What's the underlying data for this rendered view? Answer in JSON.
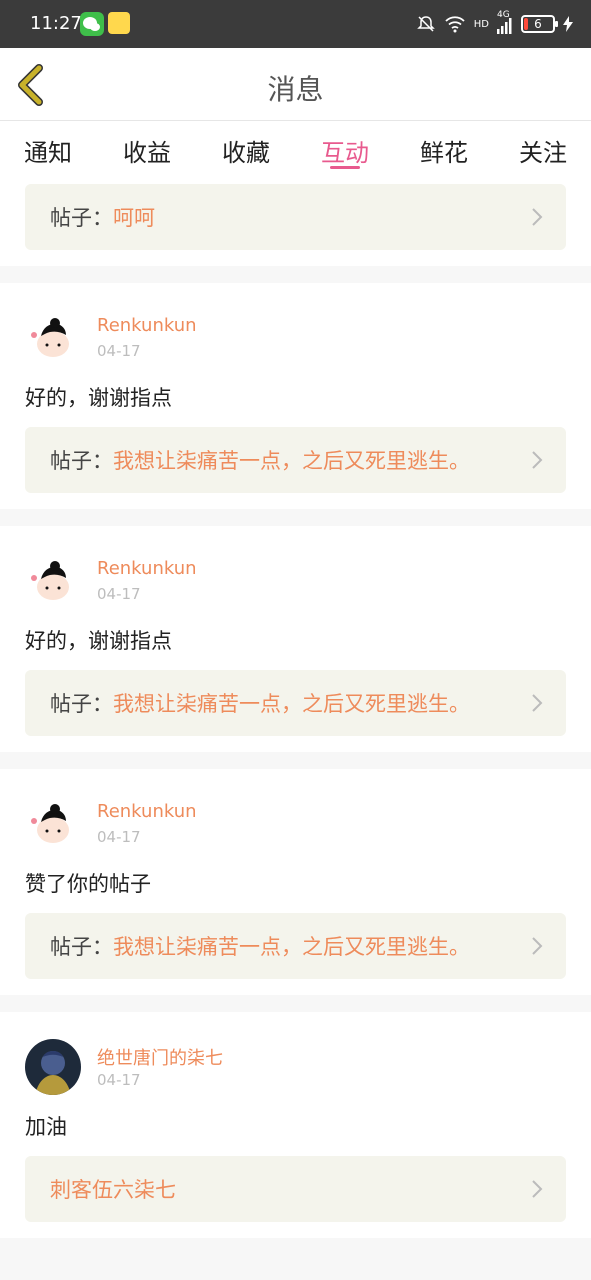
{
  "status_bar": {
    "time": "11:27",
    "network_label": "HD",
    "signal_label": "4G",
    "battery_level": "6"
  },
  "header": {
    "title": "消息"
  },
  "tabs": [
    {
      "label": "通知",
      "active": false
    },
    {
      "label": "收益",
      "active": false
    },
    {
      "label": "收藏",
      "active": false
    },
    {
      "label": "互动",
      "active": true
    },
    {
      "label": "鲜花",
      "active": false
    },
    {
      "label": "关注",
      "active": false
    }
  ],
  "post_prefix": "帖子：",
  "items": [
    {
      "type": "post-only",
      "post_title": "呵呵"
    },
    {
      "user": "Renkunkun",
      "date": "04-17",
      "message": "好的，谢谢指点",
      "post_title": "我想让柒痛苦一点，之后又死里逃生。"
    },
    {
      "user": "Renkunkun",
      "date": "04-17",
      "message": "好的，谢谢指点",
      "post_title": "我想让柒痛苦一点，之后又死里逃生。"
    },
    {
      "user": "Renkunkun",
      "date": "04-17",
      "message": "赞了你的帖子",
      "post_title": "我想让柒痛苦一点，之后又死里逃生。"
    },
    {
      "user": "绝世唐门的柒七",
      "date": "04-17",
      "message": "加油",
      "link_text": "刺客伍六柒七"
    }
  ],
  "colors": {
    "accent_pink": "#e85a8e",
    "accent_orange": "#ee8b5b",
    "back_arrow": "#c8b22a"
  }
}
